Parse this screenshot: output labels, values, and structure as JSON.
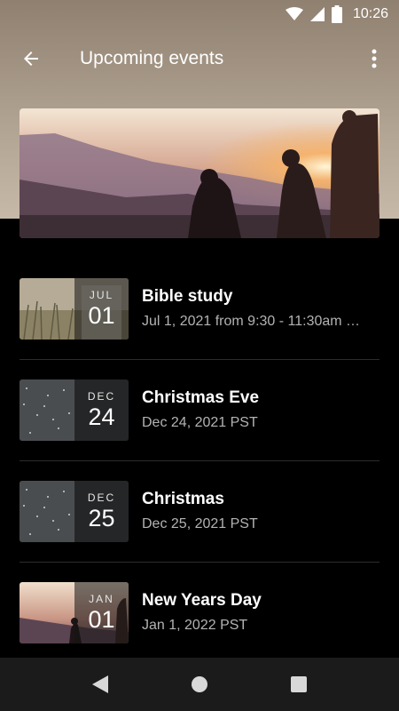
{
  "status_bar": {
    "time": "10:26",
    "icons": [
      "wifi-icon",
      "cell-signal-icon",
      "battery-icon"
    ]
  },
  "app_bar": {
    "title": "Upcoming events",
    "back_icon": "arrow-left-icon",
    "more_icon": "more-vert-icon"
  },
  "hero": {
    "image": "sunset-mountain-group-photo"
  },
  "events": [
    {
      "month": "JUL",
      "day": "01",
      "title": "Bible study",
      "subtitle": "Jul 1, 2021 from 9:30 - 11:30am …",
      "thumb": "field-grass-photo"
    },
    {
      "month": "DEC",
      "day": "24",
      "title": "Christmas Eve",
      "subtitle": "Dec 24, 2021 PST",
      "thumb": "starry-snow-photo"
    },
    {
      "month": "DEC",
      "day": "25",
      "title": "Christmas",
      "subtitle": "Dec 25, 2021 PST",
      "thumb": "starry-snow-photo"
    },
    {
      "month": "JAN",
      "day": "01",
      "title": "New Years Day",
      "subtitle": "Jan 1, 2022 PST",
      "thumb": "sunset-mountain-group-photo"
    }
  ],
  "nav_bar": {
    "icons": [
      "nav-back-icon",
      "nav-home-icon",
      "nav-recents-icon"
    ]
  },
  "colors": {
    "background": "#000000",
    "header": "#b0a291",
    "divider": "#2c2c2c",
    "subtext": "#b3b3b3",
    "navbar": "#1b1b1b"
  }
}
